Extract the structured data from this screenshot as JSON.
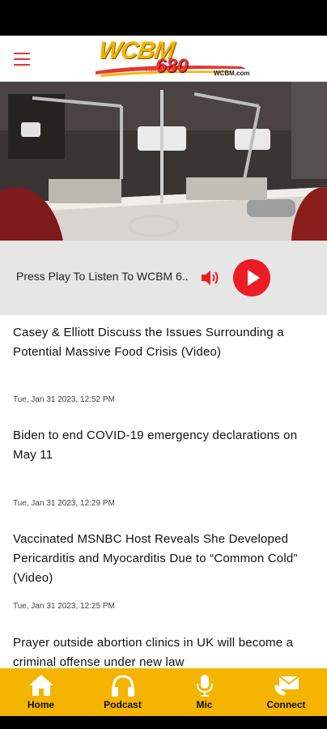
{
  "logo": {
    "brand": "WCBM",
    "am": "AM",
    "frequency": "680",
    "site": "WCBM.com"
  },
  "colors": {
    "accent_red": "#ec1c24",
    "nav_yellow": "#f4b400",
    "player_bg": "#e6e6e6"
  },
  "player": {
    "prompt": "Press Play To Listen To WCBM 6..",
    "speaker_icon": "speaker-icon",
    "play_icon": "play-icon"
  },
  "articles": [
    {
      "title": "Casey & Elliott Discuss the Issues Surrounding a Potential Massive Food Crisis (Video)",
      "date": "Tue, Jan 31 2023, 12:52 PM"
    },
    {
      "title": "Biden to end COVID-19 emergency declarations on May 11",
      "date": "Tue, Jan 31 2023, 12:29 PM"
    },
    {
      "title": "Vaccinated MSNBC Host Reveals She Developed Pericarditis and Myocarditis Due to “Common Cold” (Video)",
      "date": "Tue, Jan 31 2023, 12:25 PM"
    },
    {
      "title": "Prayer outside abortion clinics in UK will become a criminal offense under new law",
      "date": ""
    }
  ],
  "nav": [
    {
      "label": "Home",
      "icon": "home-icon"
    },
    {
      "label": "Podcast",
      "icon": "headphones-icon"
    },
    {
      "label": "Mic",
      "icon": "microphone-icon"
    },
    {
      "label": "Connect",
      "icon": "mail-icon"
    }
  ]
}
